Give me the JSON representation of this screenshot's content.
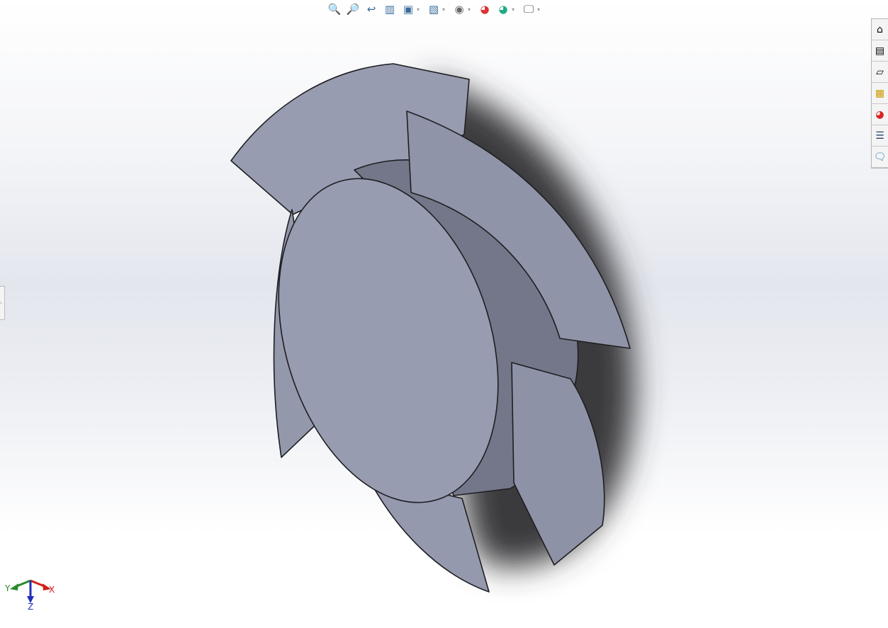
{
  "toolbar": {
    "icons": [
      "zoom-to-fit-icon",
      "zoom-to-area-icon",
      "previous-view-icon",
      "section-view-icon",
      "view-orientation-icon",
      "display-style-icon",
      "hide-show-items-icon",
      "edit-appearance-icon",
      "apply-scene-icon",
      "view-settings-icon"
    ]
  },
  "task_pane": {
    "icons": [
      "home-icon",
      "design-library-icon",
      "file-explorer-icon",
      "view-palette-icon",
      "appearances-icon",
      "custom-properties-icon",
      "forum-icon"
    ]
  },
  "triad": {
    "x_label": "X",
    "y_label": "Y",
    "z_label": "Z"
  },
  "colors": {
    "part": "#979cb0",
    "part_dark": "#737789",
    "shadow": "#3c3c3e",
    "x_axis": "#d0201a",
    "y_axis": "#2a8a2a",
    "z_axis": "#1f2fb8"
  }
}
